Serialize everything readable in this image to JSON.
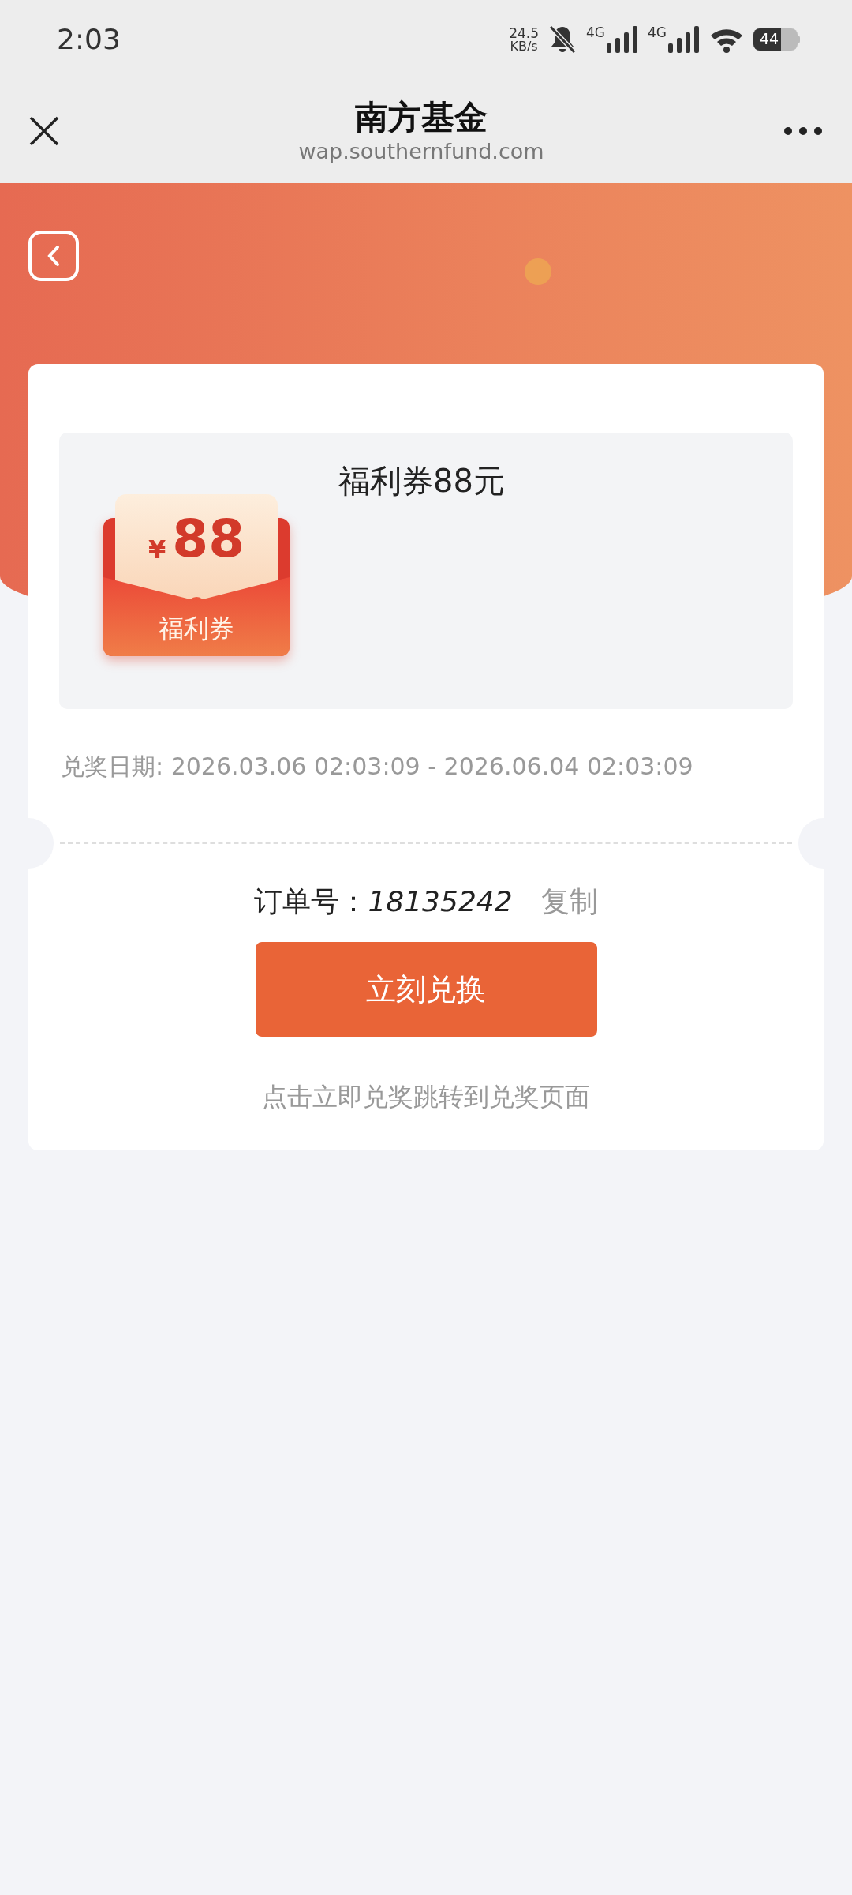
{
  "status_bar": {
    "time": "2:03",
    "net_speed": "24.5",
    "net_unit": "KB/s",
    "signals": [
      {
        "label": "4G"
      },
      {
        "label": "4G"
      }
    ],
    "battery": "44"
  },
  "header": {
    "title": "南方基金",
    "url": "wap.southernfund.com"
  },
  "coupon": {
    "badge_currency": "¥",
    "badge_amount": "88",
    "badge_label": "福利券",
    "title": "福利券88元"
  },
  "redeem_period": "兑奖日期: 2026.03.06 02:03:09 - 2026.06.04 02:03:09",
  "order": {
    "label": "订单号：",
    "number": "18135242",
    "copy": "复制"
  },
  "redeem_button": "立刻兑换",
  "hint": "点击立即兑奖跳转到兑奖页面"
}
